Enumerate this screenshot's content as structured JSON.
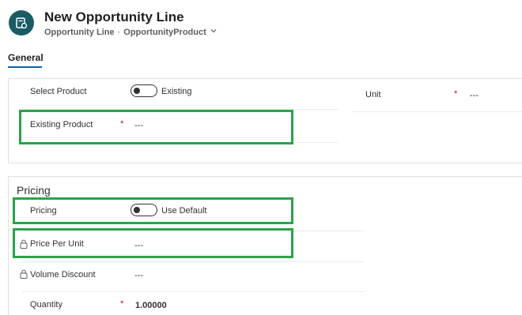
{
  "header": {
    "title": "New Opportunity Line",
    "entity": "Opportunity Line",
    "separator": "·",
    "form": "OpportunityProduct"
  },
  "tabs": [
    {
      "label": "General",
      "active": true
    }
  ],
  "general": {
    "select_product": {
      "label": "Select Product",
      "toggle_text": "Existing",
      "on": false
    },
    "existing_product": {
      "label": "Existing Product",
      "required": "*",
      "value": "---"
    },
    "unit": {
      "label": "Unit",
      "required": "*",
      "value": "---"
    }
  },
  "pricing": {
    "section_title": "Pricing",
    "pricing_toggle": {
      "label": "Pricing",
      "toggle_text": "Use Default",
      "on": false
    },
    "price_per_unit": {
      "label": "Price Per Unit",
      "value": "---",
      "locked": true
    },
    "volume_discount": {
      "label": "Volume Discount",
      "value": "---",
      "locked": true
    },
    "quantity": {
      "label": "Quantity",
      "required": "*",
      "value": "1.00000"
    }
  },
  "colors": {
    "accent": "#115ea3",
    "icon_bg": "#1b5b64",
    "required": "#c50f1f",
    "highlight": "#2aa34a"
  }
}
